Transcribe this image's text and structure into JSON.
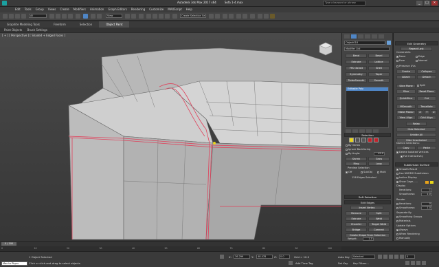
{
  "window": {
    "title": "Autodesk 3ds Max 2017 x64",
    "file": "Sofa 1-4.max",
    "search_placeholder": "Type a keyword or phrase"
  },
  "menu": [
    "Edit",
    "Tools",
    "Group",
    "Views",
    "Create",
    "Modifiers",
    "Animation",
    "Graph Editors",
    "Rendering",
    "Customize",
    "MAXScript",
    "Help"
  ],
  "toolbar": {
    "selection_filter": "All",
    "view": "View",
    "named_selection": "Create Selection Se"
  },
  "ribbon": {
    "tabs": [
      "Graphite Modeling Tools",
      "Freeform",
      "Selection",
      "Object Paint"
    ],
    "active": "Object Paint",
    "sub_tabs": [
      "Paint Objects",
      "Brush Settings"
    ]
  },
  "viewport": {
    "label": "[ + ] [ Perspective ] [ Shaded + Edged Faces ]"
  },
  "modify": {
    "object_name": "Object018",
    "modifier_list": "Modifier List",
    "buttons": [
      "Bend",
      "Bevel",
      "Extrude",
      "Lattice",
      "FFD 3x3x3",
      "Shell",
      "Symmetry",
      "Taper",
      "TurboSmooth",
      "Smooth"
    ],
    "stack_item": "Editable Poly"
  },
  "selection": {
    "header": "Selection",
    "by_vertex": "By Vertex",
    "ignore_backfacing": "Ignore Backfacing",
    "by_angle": "By Angle:",
    "angle_value": "45.0",
    "shrink": "Shrink",
    "grow": "Grow",
    "ring": "Ring",
    "loop": "Loop",
    "preview_label": "Preview Selection",
    "preview_off": "Off",
    "preview_subobj": "SubObj",
    "preview_multi": "Multi",
    "status": "158 Edges Selected"
  },
  "soft_selection": {
    "header": "Soft Selection"
  },
  "edit_edges": {
    "header": "Edit Edges",
    "insert_vertex": "Insert Vertex",
    "remove": "Remove",
    "split": "Split",
    "extrude": "Extrude",
    "weld": "Weld",
    "chamfer": "Chamfer",
    "target_weld": "Target Weld",
    "bridge": "Bridge",
    "connect": "Connect",
    "create_shape": "Create Shape From Selection",
    "weight_label": "Weight:",
    "weight_value": "1.0"
  },
  "edit_geometry": {
    "header": "Edit Geometry",
    "repeat_last": "Repeat Last",
    "constraints": "Constraints",
    "none": "None",
    "edge": "Edge",
    "face": "Face",
    "normal": "Normal",
    "preserve_uvs": "Preserve UVs",
    "create": "Create",
    "collapse": "Collapse",
    "attach": "Attach",
    "detach": "Detach",
    "slice_plane": "Slice Plane",
    "split": "Split",
    "slice": "Slice",
    "reset_plane": "Reset Plane",
    "quickslice": "QuickSlice",
    "cut": "Cut",
    "msmooth": "MSmooth",
    "tessellate": "Tessellate",
    "make_planar": "Make Planar",
    "x": "X",
    "y": "Y",
    "z": "Z",
    "view_align": "View Align",
    "grid_align": "Grid Align",
    "relax": "Relax",
    "hide_selected": "Hide Selected",
    "unhide_all": "Unhide All",
    "hide_unselected": "Hide Unselected",
    "named_selections": "Named Selections:",
    "copy": "Copy",
    "paste": "Paste",
    "delete_isolated": "Delete Isolated Vertices",
    "full_interactivity": "Full Interactivity"
  },
  "subdivision": {
    "header": "Subdivision Surface",
    "smooth_result": "Smooth Result",
    "use_nurms": "Use NURMS Subdivision",
    "isoline": "Isoline Display",
    "show_cage": "Show Cage......",
    "display": "Display",
    "iterations_label": "Iterations:",
    "iterations_value": "1",
    "smoothness_label": "Smoothness:",
    "smoothness_value": "1.0",
    "render": "Render",
    "r_iterations_value": "0",
    "r_smoothness_value": "1.0",
    "separate_by": "Separate By",
    "smoothing_groups": "Smoothing Groups",
    "materials": "Materials",
    "update_options": "Update Options",
    "always": "Always",
    "when_rendering": "When Rendering",
    "manually": "Manually"
  },
  "timeline": {
    "thumb": "0 / 100",
    "ticks": [
      "0",
      "10",
      "20",
      "30",
      "40",
      "50",
      "60",
      "70",
      "80",
      "90",
      "100"
    ]
  },
  "status": {
    "objects": "1 Object Selected",
    "prompt": "Click or click-and-drag to select objects",
    "x_label": "X:",
    "x": "36.299",
    "y_label": "Y:",
    "y": "48.478",
    "z_label": "Z:",
    "z": "0.0",
    "grid": "Grid = 10.0",
    "auto_key": "Auto Key",
    "selected": "Selected",
    "set_key": "Set Key",
    "key_filters": "Key Filters...",
    "add_time_tag": "Add Time Tag",
    "frame": "0",
    "script_prompt": "Max to Physc."
  },
  "colors": {
    "accent": "#4f86c6",
    "edge_selected": "#e0405a",
    "yellow": "#e8d51a",
    "red": "#c0222a"
  }
}
